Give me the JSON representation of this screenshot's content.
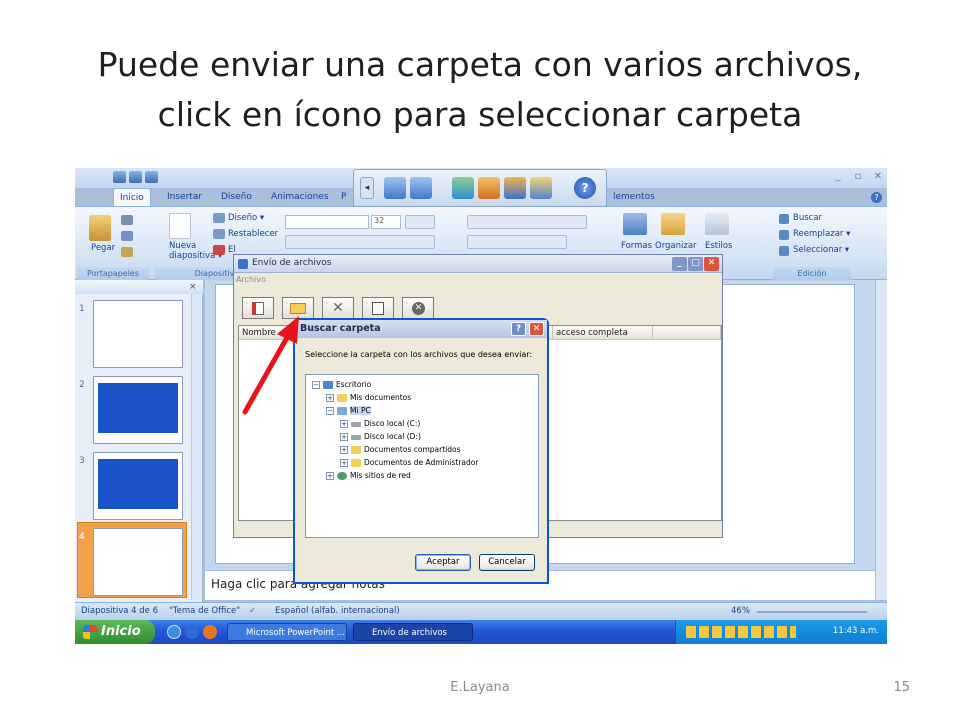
{
  "slide": {
    "title": "Puede enviar una carpeta con varios archivos,\nclick en ícono para seleccionar carpeta",
    "footer_author": "E.Layana",
    "page_number": "15"
  },
  "powerpoint": {
    "tabs": [
      "Inicio",
      "Insertar",
      "Diseño",
      "Animaciones",
      "P",
      "lementos"
    ],
    "ribbon": {
      "pegar": "Pegar",
      "portapapeles": "Portapapeles",
      "nueva_diapositiva": "Nueva\ndiapositiva ▾",
      "diseno": "Diseño ▾",
      "restablecer": "Restablecer",
      "eliminar": "El",
      "diapositivas": "Diapositiva",
      "font_size": "32",
      "formas": "Formas",
      "organizar": "Organizar",
      "estilos": "Estilos",
      "buscar": "Buscar",
      "reemplazar": "Reemplazar ▾",
      "seleccionar": "Seleccionar ▾",
      "edicion": "Edición"
    },
    "thumbnails": [
      "1",
      "2",
      "3",
      "4"
    ],
    "notes_placeholder": "Haga clic para agregar notas",
    "status": {
      "slide_info": "Diapositiva 4 de 6",
      "theme": "\"Tema de Office\"",
      "language": "Español (alfab. internacional)",
      "zoom": "46%"
    }
  },
  "taskbar": {
    "start_label": "Inicio",
    "tasks": [
      "Microsoft PowerPoint ...",
      "Envío de archivos"
    ],
    "clock": "11:43 a.m."
  },
  "dialog_envio": {
    "title": "Envío de archivos",
    "menu": "Archivo",
    "columns": [
      "Nombre",
      "acceso completa"
    ]
  },
  "dialog_buscar": {
    "title": "Buscar carpeta",
    "prompt": "Seleccione la carpeta con los archivos que desea enviar:",
    "tree": [
      {
        "label": "Escritorio",
        "level": 0,
        "toggle": "−"
      },
      {
        "label": "Mis documentos",
        "level": 1,
        "toggle": "+"
      },
      {
        "label": "Mi PC",
        "level": 1,
        "toggle": "−",
        "selected": true
      },
      {
        "label": "Disco local (C:)",
        "level": 2,
        "toggle": "+"
      },
      {
        "label": "Disco local (D:)",
        "level": 2,
        "toggle": "+"
      },
      {
        "label": "Documentos compartidos",
        "level": 2,
        "toggle": "+"
      },
      {
        "label": "Documentos de Administrador",
        "level": 2,
        "toggle": "+"
      },
      {
        "label": "Mis sitios de red",
        "level": 1,
        "toggle": "+"
      }
    ],
    "accept_label": "Aceptar",
    "cancel_label": "Cancelar"
  },
  "colors": {
    "annotation_arrow": "#e8141b",
    "ribbon_text": "#15428b",
    "xp_taskbar": "#2457d6"
  }
}
